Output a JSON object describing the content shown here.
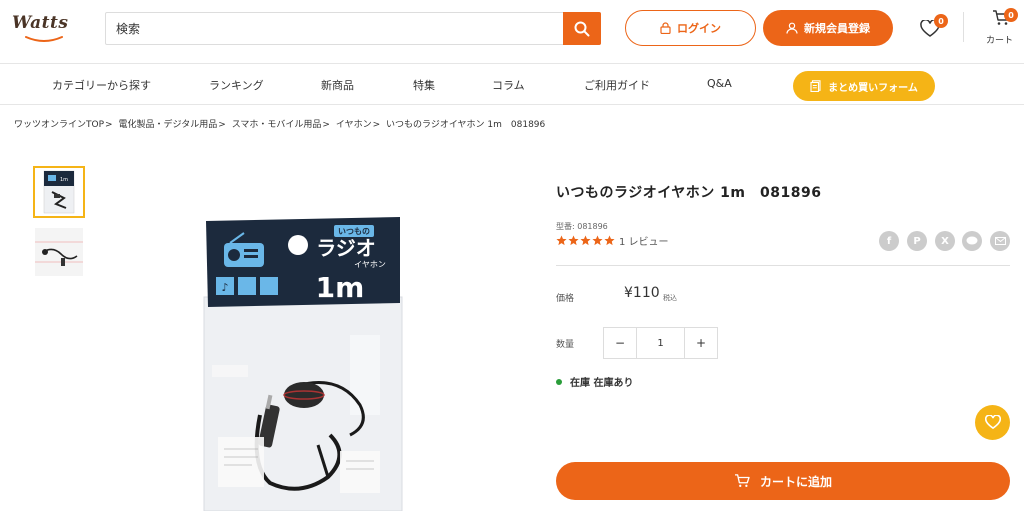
{
  "header": {
    "logo": "Watts",
    "search_placeholder": "検索",
    "login_label": "ログイン",
    "register_label": "新規会員登録",
    "wishlist_count": "0",
    "cart_count": "0",
    "cart_label": "カート"
  },
  "nav": {
    "items": [
      "カテゴリーから探す",
      "ランキング",
      "新商品",
      "特集",
      "コラム",
      "ご利用ガイド",
      "Q&A"
    ],
    "bulk_order_label": "まとめ買いフォーム"
  },
  "breadcrumb": [
    "ワッツオンラインTOP",
    "電化製品・デジタル用品",
    "スマホ・モバイル用品",
    "イヤホン",
    "いつものラジオイヤホン 1m　081896"
  ],
  "product": {
    "title": "いつものラジオイヤホン 1m　081896",
    "sku": "型番: 081896",
    "rating": 5,
    "review_text": "1 レビュー",
    "price_label": "価格",
    "price": "¥110",
    "tax_label": "税込",
    "qty_label": "数量",
    "qty_minus": "−",
    "qty_value": "1",
    "qty_plus": "+",
    "stock_text": "在庫 在庫あり",
    "add_to_cart_label": "カートに追加",
    "package_small": "いつもの",
    "package_title": "ラジオ",
    "package_sub": "イヤホン",
    "package_length": "1m"
  },
  "share_icons": [
    "facebook-icon",
    "pinterest-icon",
    "x-icon",
    "line-icon",
    "mail-icon"
  ],
  "colors": {
    "accent": "#ec6518",
    "yellow": "#f5b416",
    "stock_green": "#2a9d3a"
  }
}
